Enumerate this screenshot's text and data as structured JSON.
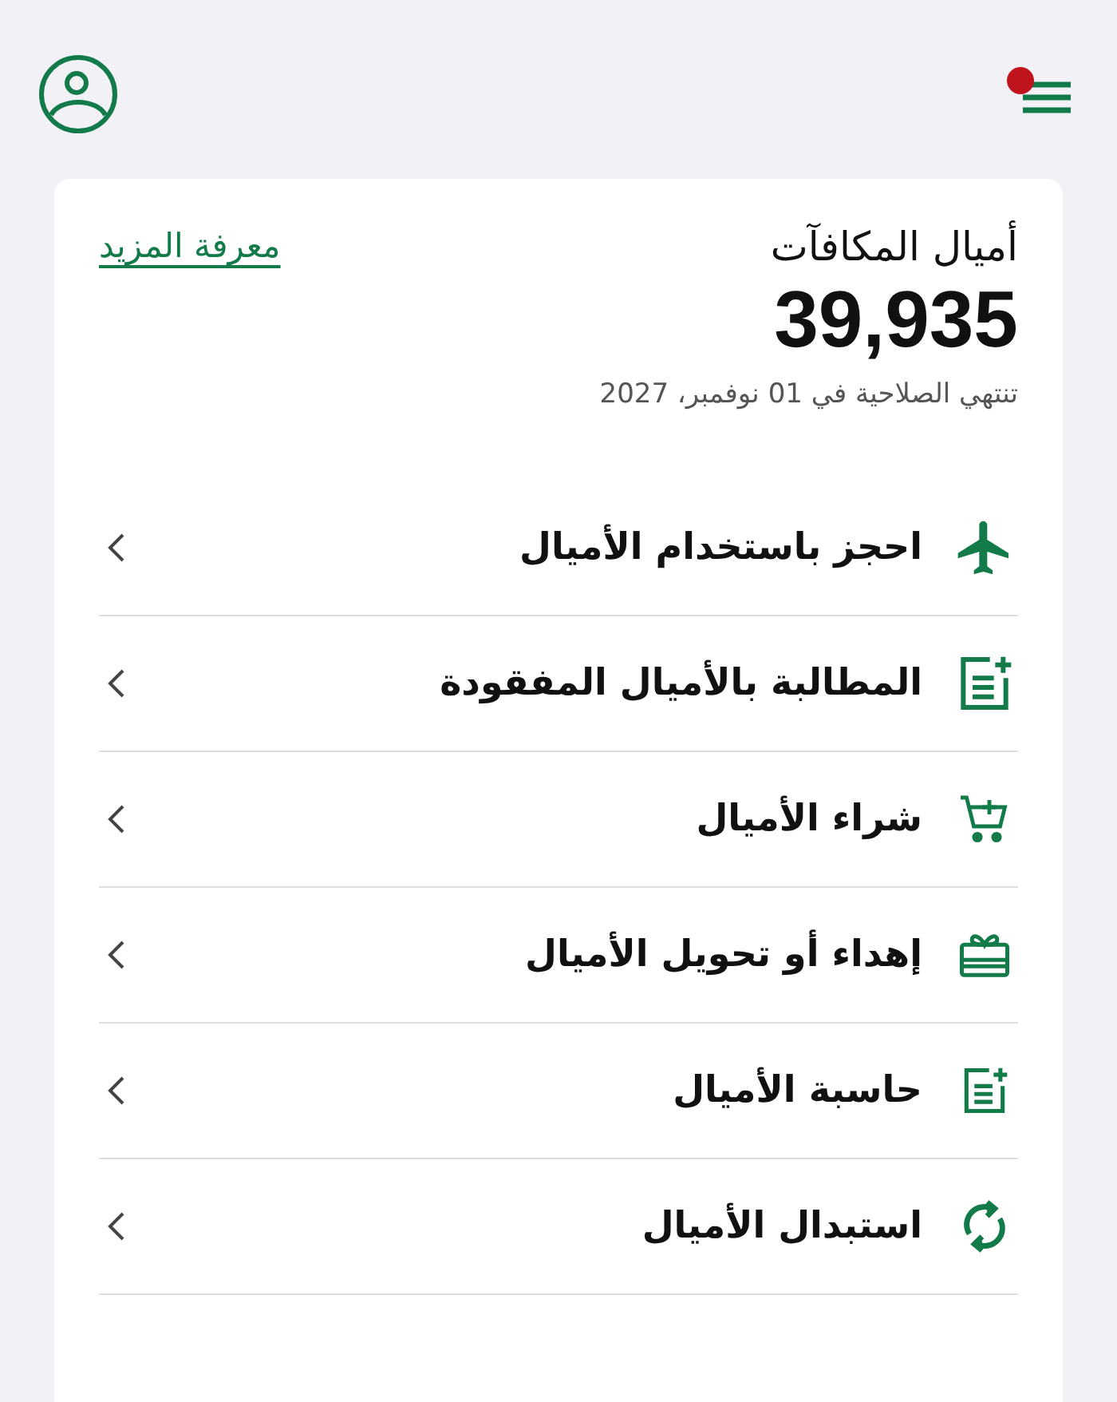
{
  "header": {
    "has_notification": true
  },
  "rewards": {
    "title": "أميال المكافآت",
    "balance": "39,935",
    "expiry": "تنتهي الصلاحية في  01 نوفمبر، 2027",
    "link": "معرفة المزيد"
  },
  "menu_items": [
    {
      "kind": "plane",
      "label": "احجز باستخدام الأميال"
    },
    {
      "kind": "claim",
      "label": "المطالبة بالأميال المفقودة"
    },
    {
      "kind": "cart",
      "label": "شراء الأميال"
    },
    {
      "kind": "gift",
      "label": "إهداء أو تحويل الأميال"
    },
    {
      "kind": "calculator",
      "label": "حاسبة الأميال"
    },
    {
      "kind": "exchange",
      "label": "استبدال الأميال"
    }
  ]
}
